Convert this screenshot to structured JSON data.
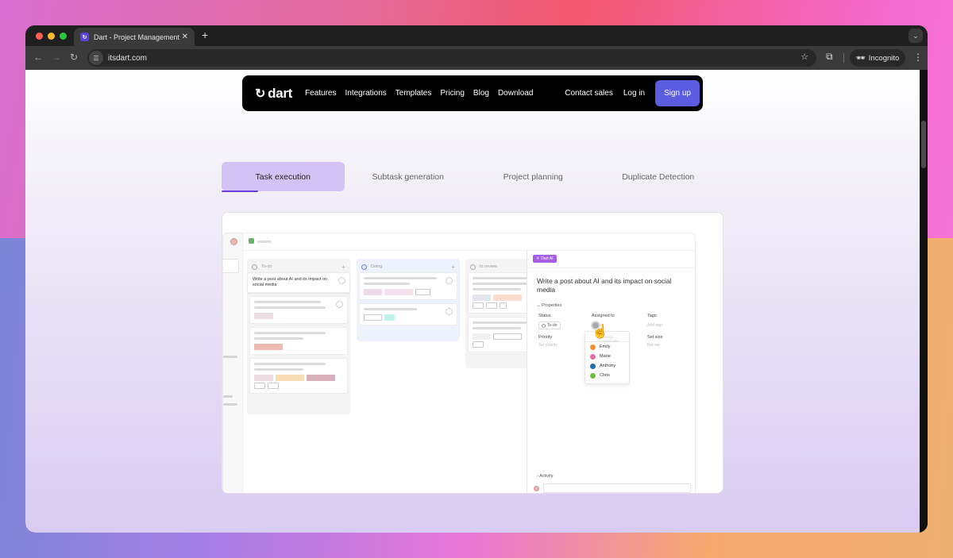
{
  "browser": {
    "tab_title": "Dart - Project Management",
    "tab_favicon": "dart-logo-icon",
    "new_tab_label": "+",
    "url": "itsdart.com",
    "incognito_label": "Incognito",
    "traffic_light_colors": [
      "#ff5f57",
      "#febc2e",
      "#28c840"
    ]
  },
  "site_nav": {
    "logo_text": "dart",
    "links": [
      "Features",
      "Integrations",
      "Templates",
      "Pricing",
      "Blog",
      "Download"
    ],
    "contact_sales": "Contact sales",
    "login": "Log in",
    "signup": "Sign up",
    "accent_color": "#5c5ce0"
  },
  "feature_tabs": [
    {
      "label": "Task execution",
      "active": true,
      "progress": 0.3
    },
    {
      "label": "Subtask generation",
      "active": false
    },
    {
      "label": "Project planning",
      "active": false
    },
    {
      "label": "Duplicate Detection",
      "active": false
    }
  ],
  "demo": {
    "columns": [
      {
        "name": "To-do",
        "icon": "todo-circle-icon"
      },
      {
        "name": "Doing",
        "icon": "doing-clock-icon"
      },
      {
        "name": "In review",
        "icon": "review-clock-icon"
      }
    ],
    "highlight_task": "Write a post about AI and its impact on social media",
    "detail": {
      "badge": "Dart AI",
      "title": "Write a post about AI and its impact on social media",
      "properties_label": "Properties",
      "status_label": "Status",
      "status_value": "To-do",
      "assigned_label": "Assigned to",
      "tags_label": "Tags",
      "tags_value": "Add tags",
      "priority_label": "Priority",
      "priority_value": "Set priority",
      "size_label": "Set size",
      "size_value": "Not set",
      "dropdown_placeholder": "Assign teammate",
      "assignees": [
        {
          "name": "Emily",
          "color": "#f0902a"
        },
        {
          "name": "Marie",
          "color": "#e66aa8"
        },
        {
          "name": "Anthony",
          "color": "#1f6fb0"
        },
        {
          "name": "Chris",
          "color": "#6cc040"
        }
      ],
      "activity_label": "Activity"
    }
  }
}
